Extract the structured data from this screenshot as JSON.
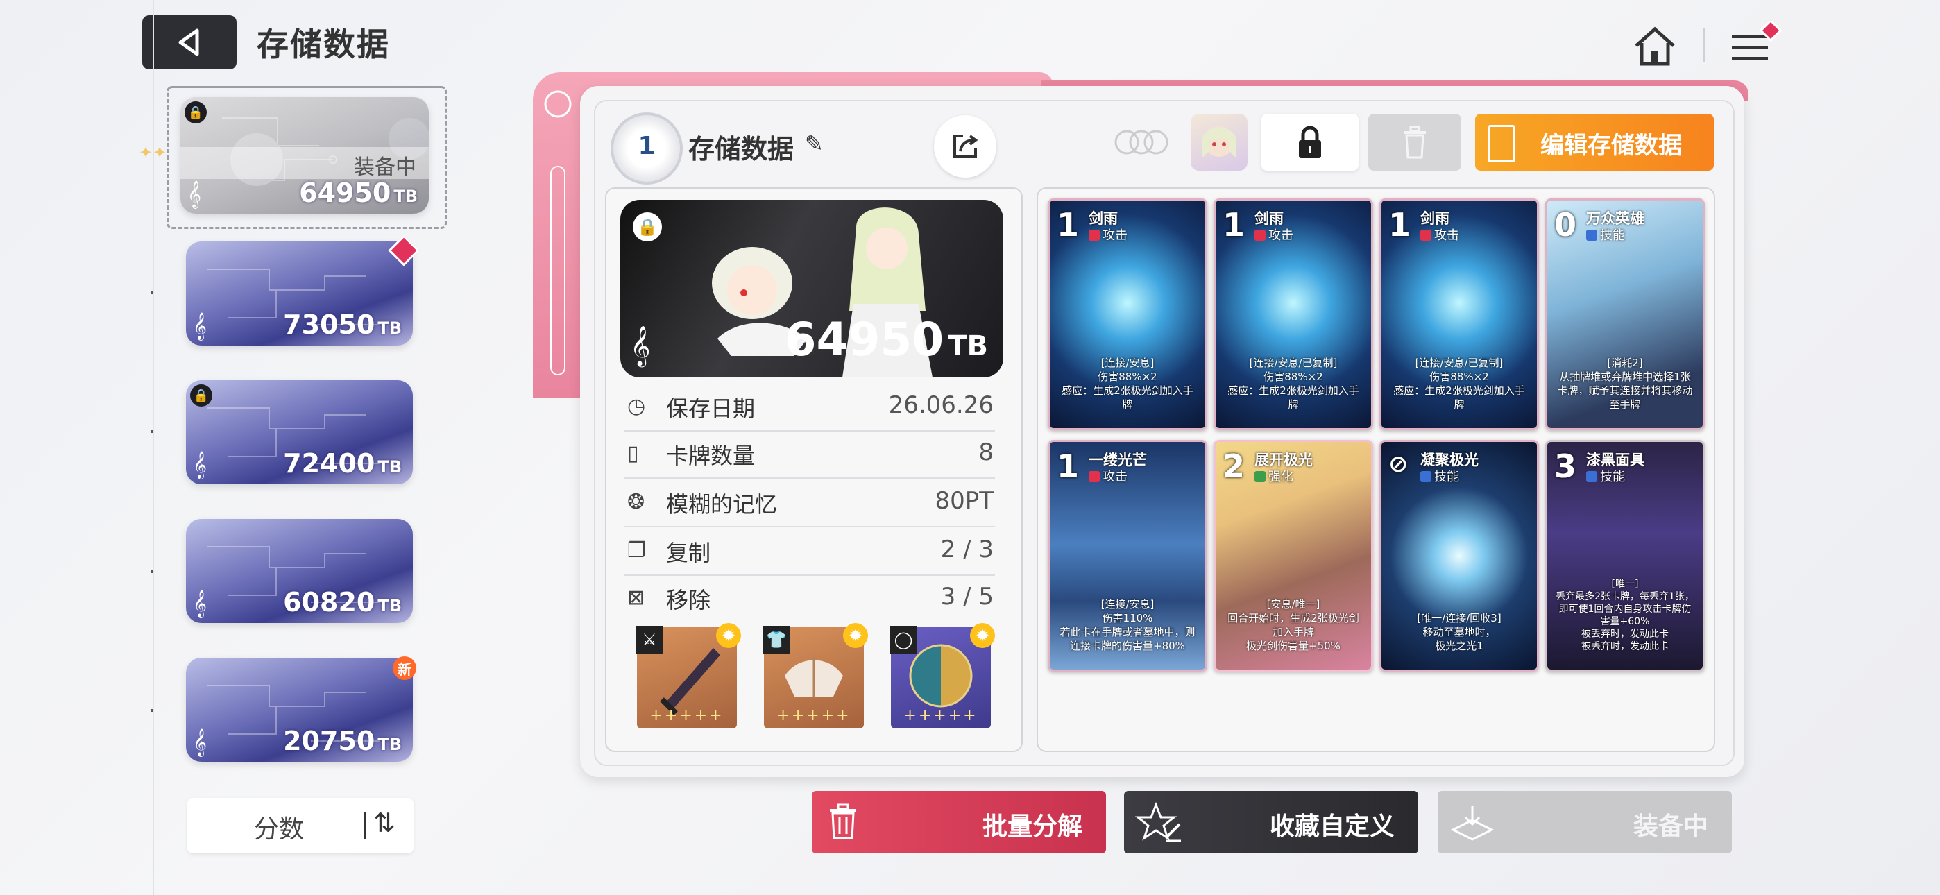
{
  "header": {
    "title": "存储数据"
  },
  "colors": {
    "accent_orange": "#f7931e",
    "pink": "#e9859e",
    "danger": "#d33b56",
    "dark": "#2d2e33"
  },
  "slots": [
    {
      "score": "64950",
      "unit": "TB",
      "locked": true,
      "equipped_label": "装备中"
    },
    {
      "score": "73050",
      "unit": "TB",
      "badge": "diamond"
    },
    {
      "score": "72400",
      "unit": "TB",
      "locked": true
    },
    {
      "score": "60820",
      "unit": "TB"
    },
    {
      "score": "20750",
      "unit": "TB",
      "badge": "新"
    }
  ],
  "sort": {
    "label": "分数"
  },
  "deck": {
    "number": "1",
    "name": "存储数据",
    "score": "64950",
    "unit": "TB",
    "edit_label": "编辑存储数据",
    "stats": [
      {
        "icon": "clock-icon",
        "label": "保存日期",
        "value": "26.06.26"
      },
      {
        "icon": "cards-icon",
        "label": "卡牌数量",
        "value": "8"
      },
      {
        "icon": "brain-icon",
        "label": "模糊的记忆",
        "value": "80PT"
      },
      {
        "icon": "copy-icon",
        "label": "复制",
        "value": "2 / 3"
      },
      {
        "icon": "remove-icon",
        "label": "移除",
        "value": "3 / 5"
      }
    ],
    "equipment": [
      {
        "slot_icon": "sword-icon",
        "stars": "+++++"
      },
      {
        "slot_icon": "armor-icon",
        "stars": "+++++"
      },
      {
        "slot_icon": "ring-icon",
        "stars": "+++++"
      }
    ]
  },
  "cards": [
    {
      "cost": "1",
      "name": "剑雨",
      "type": "攻击",
      "text": "[连接/安息]\n伤害88%×2\n感应：生成2张极光剑加入手牌"
    },
    {
      "cost": "1",
      "name": "剑雨",
      "type": "攻击",
      "text": "[连接/安息/已复制]\n伤害88%×2\n感应：生成2张极光剑加入手牌"
    },
    {
      "cost": "1",
      "name": "剑雨",
      "type": "攻击",
      "text": "[连接/安息/已复制]\n伤害88%×2\n感应：生成2张极光剑加入手牌"
    },
    {
      "cost": "0",
      "name": "万众英雄",
      "type": "技能",
      "text": "[消耗2]\n从抽牌堆或弃牌堆中选择1张卡牌，赋予其连接并将其移动至手牌"
    },
    {
      "cost": "1",
      "name": "一缕光芒",
      "type": "攻击",
      "text": "[连接/安息]\n伤害110%\n若此卡在手牌或者墓地中，则连接卡牌的伤害量+80%"
    },
    {
      "cost": "2",
      "name": "展开极光",
      "type": "强化",
      "text": "[安息/唯一]\n回合开始时，生成2张极光剑加入手牌\n极光剑伤害量+50%"
    },
    {
      "cost": "⊘",
      "name": "凝聚极光",
      "type": "技能",
      "text": "[唯一/连接/回收3]\n移动至墓地时，\n极光之光1"
    },
    {
      "cost": "3",
      "name": "漆黑面具",
      "type": "技能",
      "text": "[唯一]\n丢弃最多2张卡牌，每丢弃1张，即可使1回合内自身攻击卡牌伤害量+60%\n被丢弃时，发动此卡\n被丢弃时，发动此卡"
    }
  ],
  "bottom": {
    "disassemble": "批量分解",
    "favorite": "收藏自定义",
    "equipped": "装备中"
  }
}
